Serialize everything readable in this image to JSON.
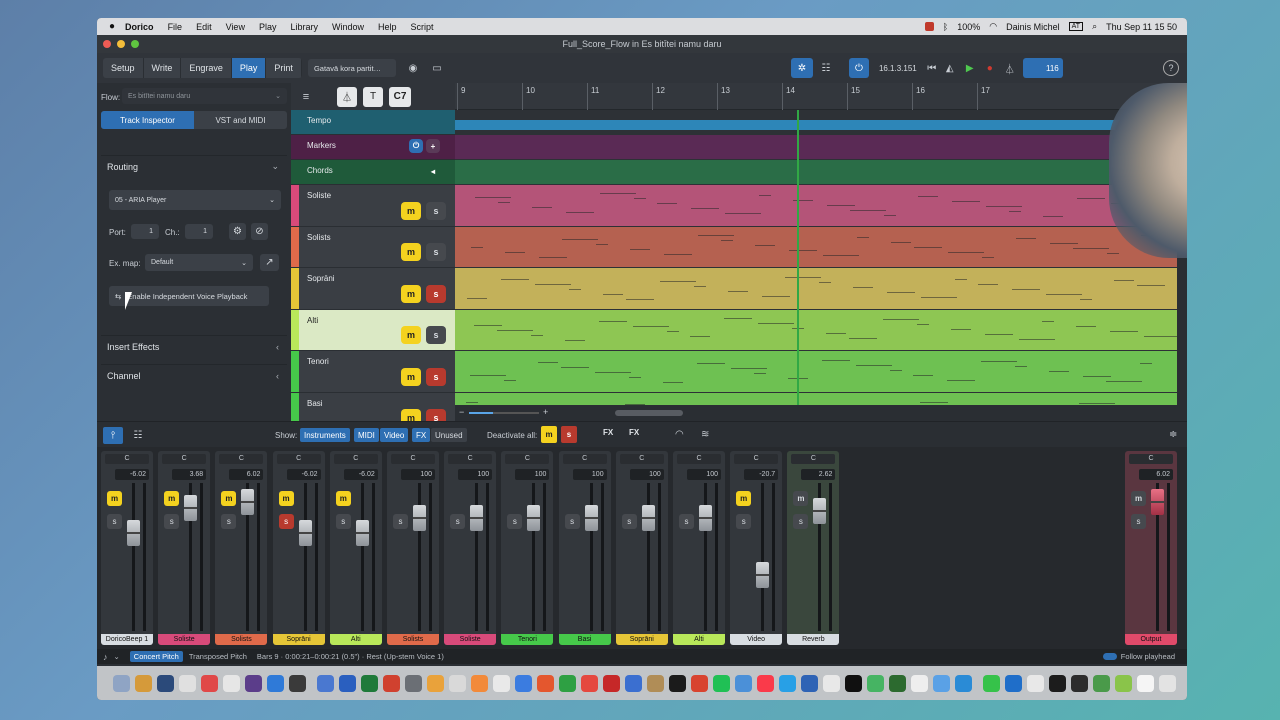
{
  "menubar": {
    "apple": "",
    "app": "Dorico",
    "items": [
      "File",
      "Edit",
      "View",
      "Play",
      "Library",
      "Window",
      "Help",
      "Script"
    ],
    "battery": "100%",
    "user": "Dainis Michel",
    "input": "AT",
    "datetime": "Thu Sep 11  15 50"
  },
  "window": {
    "title": "Full_Score_Flow in Es bitītei namu daru"
  },
  "toolbar": {
    "modes": [
      "Setup",
      "Write",
      "Engrave",
      "Play",
      "Print"
    ],
    "active_mode": "Play",
    "layout_select": "Gatavā kora partit…",
    "position": "16.1.3.151",
    "tempo": "116"
  },
  "flow": {
    "label": "Flow:",
    "value": "Es bitītei namu daru"
  },
  "inspector": {
    "tabs": [
      "Track Inspector",
      "VST and MIDI"
    ],
    "routing_label": "Routing",
    "player": "05 - ARIA Player",
    "port_label": "Port:",
    "port_value": "1",
    "ch_label": "Ch.:",
    "ch_value": "1",
    "exmap_label": "Ex. map:",
    "exmap_value": "Default",
    "enable_button": "Enable Independent Voice Playback",
    "insert_effects": "Insert Effects",
    "channel": "Channel"
  },
  "track_toolbar": {
    "chord_symbol": "C7"
  },
  "tracks": [
    {
      "name": "Tempo",
      "color": "#1f5f70",
      "lane": "#2d86b8"
    },
    {
      "name": "Markers",
      "color": "#4e2046",
      "lane": "#5a2a55"
    },
    {
      "name": "Chords",
      "color": "#1f5a3a",
      "lane": "#2a6d47"
    },
    {
      "name": "Soliste",
      "color": "#d84a7a",
      "lane": "#b45478",
      "solo": false
    },
    {
      "name": "Solists",
      "color": "#e06a4a",
      "lane": "#b56150",
      "solo": false
    },
    {
      "name": "Soprāni",
      "color": "#e6c637",
      "lane": "#c3b15a",
      "solo": true
    },
    {
      "name": "Alti",
      "color": "#b9e85a",
      "lane": "#8ec653",
      "solo": false
    },
    {
      "name": "Tenori",
      "color": "#46c94a",
      "lane": "#6ec152",
      "solo": true
    },
    {
      "name": "Basi",
      "color": "#46c94a",
      "lane": "#6ec152",
      "solo": true
    }
  ],
  "ruler": [
    "9",
    "10",
    "11",
    "12",
    "13",
    "14",
    "15",
    "16",
    "17"
  ],
  "bottombar": {
    "show_label": "Show:",
    "filters": [
      "Instruments",
      "MIDI",
      "Video",
      "FX",
      "Unused"
    ],
    "deactivate_label": "Deactivate all:",
    "m": "m",
    "s": "s",
    "fx1": "FX",
    "fx2": "FX"
  },
  "mixer": [
    {
      "name": "DoricoBeep 1",
      "pan": "C",
      "vol": "-6.02",
      "color": "#d8dde2",
      "m": true,
      "fader": 0.7
    },
    {
      "name": "Soliste",
      "pan": "C",
      "vol": "3.68",
      "color": "#d84a7a",
      "m": true,
      "fader": 0.9
    },
    {
      "name": "Solists",
      "pan": "C",
      "vol": "6.02",
      "color": "#e06a4a",
      "m": true,
      "fader": 0.95
    },
    {
      "name": "Soprāni",
      "pan": "C",
      "vol": "-6.02",
      "color": "#e6c637",
      "m": true,
      "srd": true,
      "fader": 0.7
    },
    {
      "name": "Alti",
      "pan": "C",
      "vol": "-6.02",
      "color": "#b9e85a",
      "m": true,
      "fader": 0.7
    },
    {
      "name": "Solists",
      "pan": "C",
      "vol": "100",
      "color": "#e06a4a",
      "m": false,
      "fader": 0.82
    },
    {
      "name": "Soliste",
      "pan": "C",
      "vol": "100",
      "color": "#d84a7a",
      "m": false,
      "fader": 0.82
    },
    {
      "name": "Tenori",
      "pan": "C",
      "vol": "100",
      "color": "#46c94a",
      "m": false,
      "fader": 0.82
    },
    {
      "name": "Basi",
      "pan": "C",
      "vol": "100",
      "color": "#46c94a",
      "m": false,
      "fader": 0.82
    },
    {
      "name": "Soprāni",
      "pan": "C",
      "vol": "100",
      "color": "#e6c637",
      "m": false,
      "fader": 0.82
    },
    {
      "name": "Alti",
      "pan": "C",
      "vol": "100",
      "color": "#b9e85a",
      "m": false,
      "fader": 0.82
    },
    {
      "name": "Video",
      "pan": "C",
      "vol": "-20.7",
      "color": "#d8dde2",
      "m": true,
      "fader": 0.35
    },
    {
      "name": "Reverb",
      "pan": "C",
      "vol": "2.62",
      "color": "#d8dde2",
      "m": false,
      "fx": true,
      "fader": 0.88
    },
    {
      "name": "Output",
      "pan": "C",
      "vol": "6.02",
      "color": "#e04a6a",
      "m": false,
      "out": true,
      "fader": 0.95
    }
  ],
  "statusbar": {
    "concert": "Concert Pitch",
    "transposed": "Transposed Pitch",
    "info": "Bars 9 · 0:00:21–0:00:21 (0.5\") · Rest (Up-stem Voice 1)",
    "follow": "Follow playhead"
  },
  "colors": {
    "accent": "#2e6fb3",
    "mute": "#f4d21f",
    "solo_active": "#b83a2e"
  }
}
